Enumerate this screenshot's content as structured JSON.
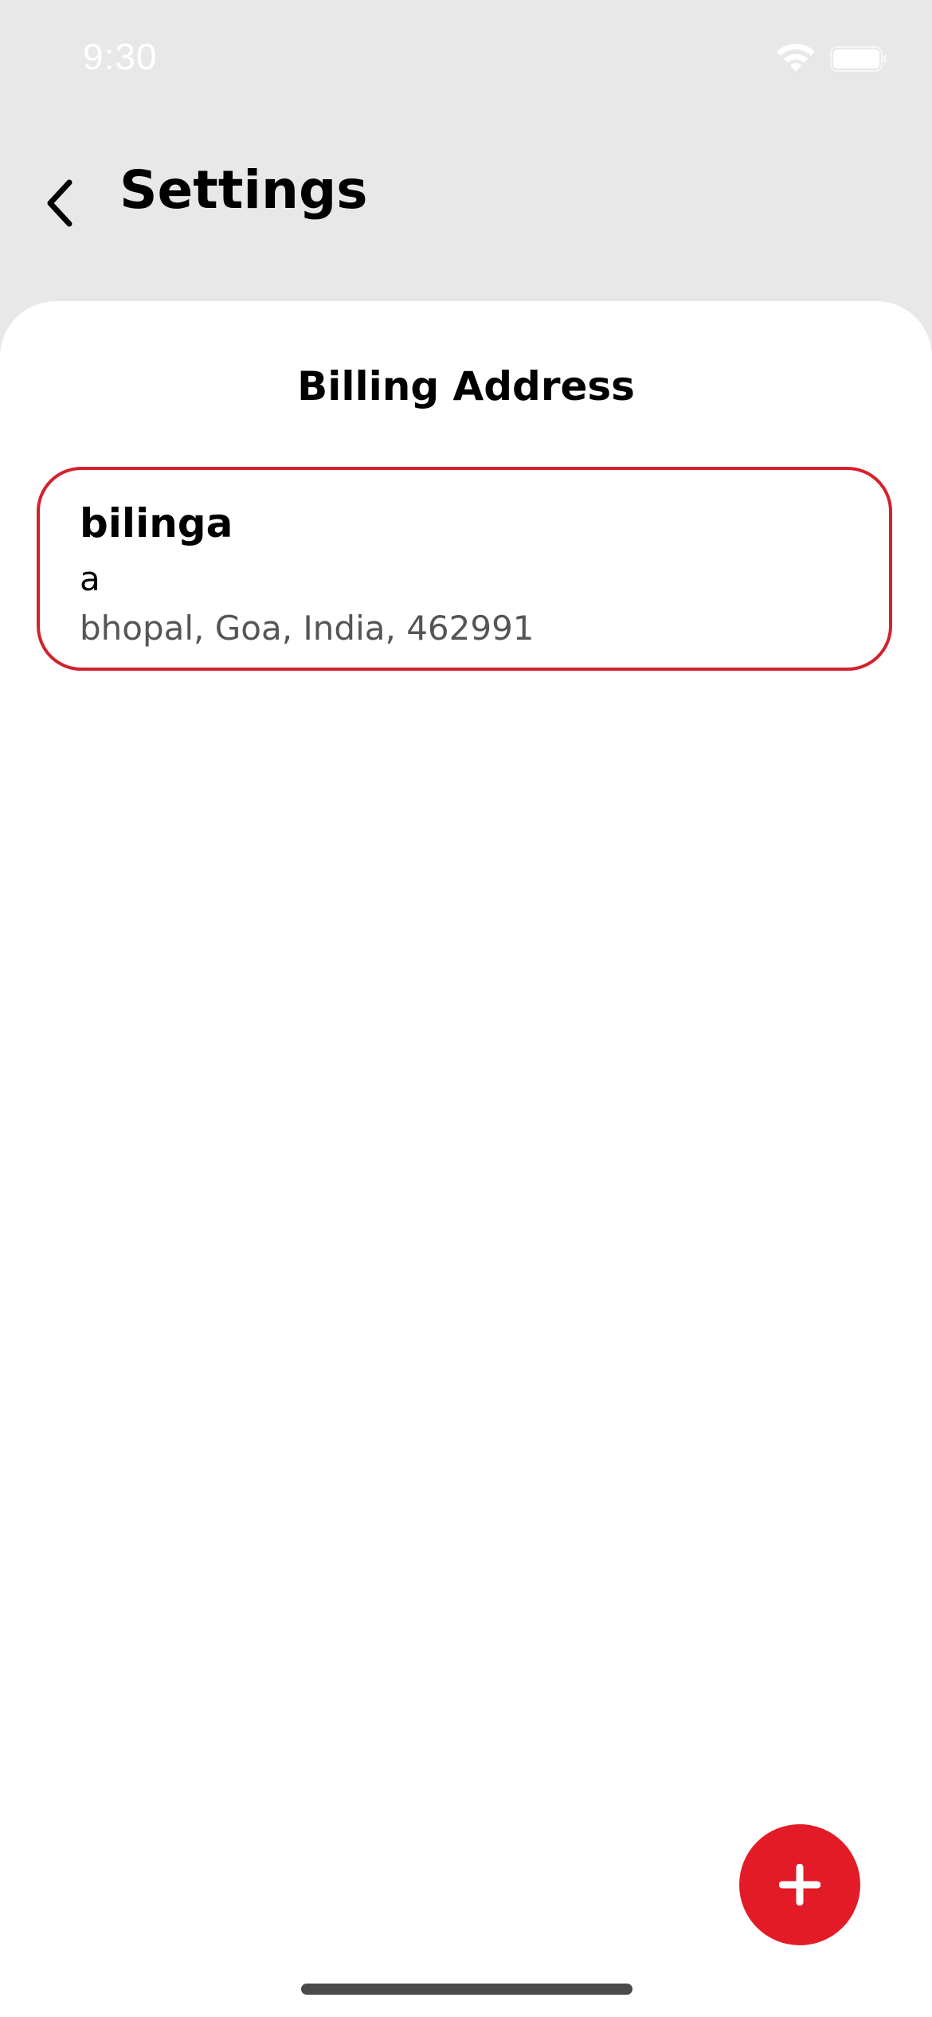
{
  "status_bar": {
    "time": "9:30",
    "icons": [
      "wifi-icon",
      "battery-icon"
    ]
  },
  "header": {
    "back_icon": "chevron-left-icon",
    "title": "Settings"
  },
  "section": {
    "title": "Billing Address"
  },
  "addresses": [
    {
      "name": "bilinga",
      "line1": "a",
      "line2": "bhopal, Goa, India, 462991"
    }
  ],
  "fab": {
    "icon": "plus-icon"
  },
  "colors": {
    "accent": "#e21b27",
    "card_border": "#d3212d",
    "header_bg": "#e8e8e8",
    "content_bg": "#ffffff"
  }
}
